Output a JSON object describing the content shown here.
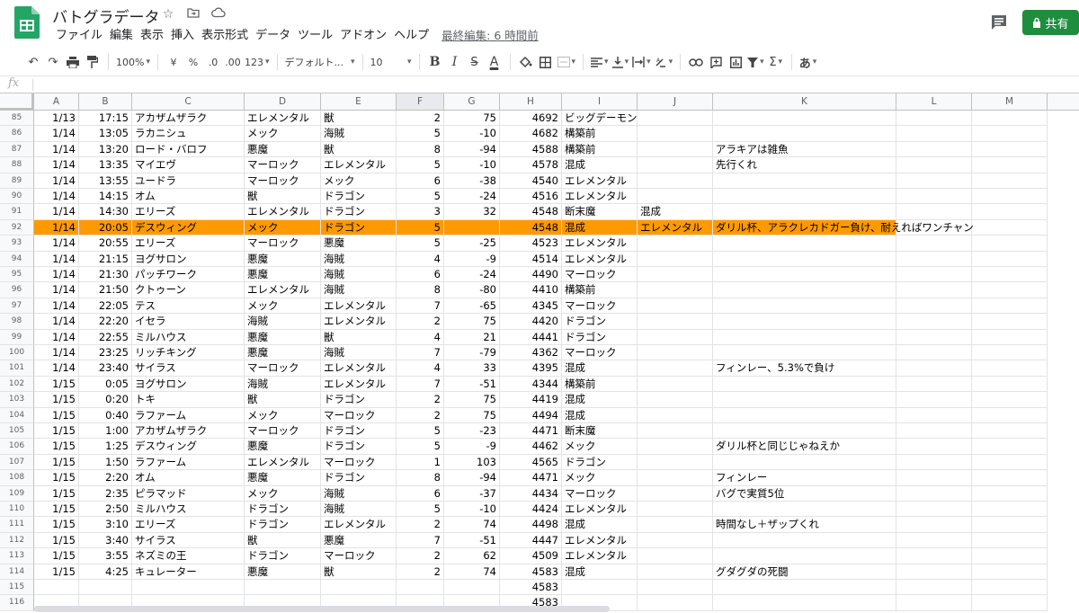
{
  "app": {
    "title": "バトグラデータ",
    "last_edit": "最終編集: 6 時間前",
    "share_label": "共有",
    "menu": [
      "ファイル",
      "編集",
      "表示",
      "挿入",
      "表示形式",
      "データ",
      "ツール",
      "アドオン",
      "ヘルプ"
    ],
    "accent_color": "#1e8e3e",
    "highlight_color": "#ff9900"
  },
  "toolbar": {
    "zoom": "100%",
    "currency": "¥",
    "percent": "%",
    "dec_less": ".0",
    "dec_more": ".00",
    "format_more": "123",
    "font": "デフォルト...",
    "font_size": "10",
    "bold": "B",
    "italic": "I",
    "strike": "S",
    "text_color": "A",
    "ime": "あ"
  },
  "formula_bar": {
    "fx": "fx",
    "value": ""
  },
  "columns": [
    "A",
    "B",
    "C",
    "D",
    "E",
    "F",
    "G",
    "H",
    "I",
    "J",
    "K",
    "L",
    "M"
  ],
  "highlighted_row": 92,
  "rows": [
    {
      "n": "85",
      "a": "1/13",
      "b": "17:15",
      "c": "アカザムザラク",
      "d": "エレメンタル",
      "e": "獣",
      "f": "2",
      "g": "75",
      "h": "4692",
      "i": "ビッグデーモン",
      "j": "",
      "k": ""
    },
    {
      "n": "86",
      "a": "1/14",
      "b": "13:05",
      "c": "ラカニシュ",
      "d": "メック",
      "e": "海賊",
      "f": "5",
      "g": "-10",
      "h": "4682",
      "i": "構築前",
      "j": "",
      "k": ""
    },
    {
      "n": "87",
      "a": "1/14",
      "b": "13:20",
      "c": "ロード・バロフ",
      "d": "悪魔",
      "e": "獣",
      "f": "8",
      "g": "-94",
      "h": "4588",
      "i": "構築前",
      "j": "",
      "k": "アラキアは雑魚"
    },
    {
      "n": "88",
      "a": "1/14",
      "b": "13:35",
      "c": "マイエヴ",
      "d": "マーロック",
      "e": "エレメンタル",
      "f": "5",
      "g": "-10",
      "h": "4578",
      "i": "混成",
      "j": "",
      "k": "先行くれ"
    },
    {
      "n": "89",
      "a": "1/14",
      "b": "13:55",
      "c": "ユードラ",
      "d": "マーロック",
      "e": "メック",
      "f": "6",
      "g": "-38",
      "h": "4540",
      "i": "エレメンタル",
      "j": "",
      "k": ""
    },
    {
      "n": "90",
      "a": "1/14",
      "b": "14:15",
      "c": "オム",
      "d": "獣",
      "e": "ドラゴン",
      "f": "5",
      "g": "-24",
      "h": "4516",
      "i": "エレメンタル",
      "j": "",
      "k": ""
    },
    {
      "n": "91",
      "a": "1/14",
      "b": "14:30",
      "c": "エリーズ",
      "d": "エレメンタル",
      "e": "ドラゴン",
      "f": "3",
      "g": "32",
      "h": "4548",
      "i": "断末魔",
      "j": "混成",
      "k": ""
    },
    {
      "n": "92",
      "a": "1/14",
      "b": "20:05",
      "c": "デスウィング",
      "d": "メック",
      "e": "ドラゴン",
      "f": "5",
      "g": "",
      "h": "4548",
      "i": "混成",
      "j": "エレメンタル",
      "k": "ダリル杯、アラクレカドガー負け、耐えればワンチャン"
    },
    {
      "n": "93",
      "a": "1/14",
      "b": "20:55",
      "c": "エリーズ",
      "d": "マーロック",
      "e": "悪魔",
      "f": "5",
      "g": "-25",
      "h": "4523",
      "i": "エレメンタル",
      "j": "",
      "k": ""
    },
    {
      "n": "94",
      "a": "1/14",
      "b": "21:15",
      "c": "ヨグサロン",
      "d": "悪魔",
      "e": "海賊",
      "f": "4",
      "g": "-9",
      "h": "4514",
      "i": "エレメンタル",
      "j": "",
      "k": ""
    },
    {
      "n": "95",
      "a": "1/14",
      "b": "21:30",
      "c": "パッチワーク",
      "d": "悪魔",
      "e": "海賊",
      "f": "6",
      "g": "-24",
      "h": "4490",
      "i": "マーロック",
      "j": "",
      "k": ""
    },
    {
      "n": "96",
      "a": "1/14",
      "b": "21:50",
      "c": "クトゥーン",
      "d": "エレメンタル",
      "e": "海賊",
      "f": "8",
      "g": "-80",
      "h": "4410",
      "i": "構築前",
      "j": "",
      "k": ""
    },
    {
      "n": "97",
      "a": "1/14",
      "b": "22:05",
      "c": "テス",
      "d": "メック",
      "e": "エレメンタル",
      "f": "7",
      "g": "-65",
      "h": "4345",
      "i": "マーロック",
      "j": "",
      "k": ""
    },
    {
      "n": "98",
      "a": "1/14",
      "b": "22:20",
      "c": "イセラ",
      "d": "海賊",
      "e": "エレメンタル",
      "f": "2",
      "g": "75",
      "h": "4420",
      "i": "ドラゴン",
      "j": "",
      "k": ""
    },
    {
      "n": "99",
      "a": "1/14",
      "b": "22:55",
      "c": "ミルハウス",
      "d": "悪魔",
      "e": "獣",
      "f": "4",
      "g": "21",
      "h": "4441",
      "i": "ドラゴン",
      "j": "",
      "k": ""
    },
    {
      "n": "100",
      "a": "1/14",
      "b": "23:25",
      "c": "リッチキング",
      "d": "悪魔",
      "e": "海賊",
      "f": "7",
      "g": "-79",
      "h": "4362",
      "i": "マーロック",
      "j": "",
      "k": ""
    },
    {
      "n": "101",
      "a": "1/14",
      "b": "23:40",
      "c": "サイラス",
      "d": "マーロック",
      "e": "エレメンタル",
      "f": "4",
      "g": "33",
      "h": "4395",
      "i": "混成",
      "j": "",
      "k": "フィンレー、5.3%で負け"
    },
    {
      "n": "102",
      "a": "1/15",
      "b": "0:05",
      "c": "ヨグサロン",
      "d": "海賊",
      "e": "エレメンタル",
      "f": "7",
      "g": "-51",
      "h": "4344",
      "i": "構築前",
      "j": "",
      "k": ""
    },
    {
      "n": "103",
      "a": "1/15",
      "b": "0:20",
      "c": "トキ",
      "d": "獣",
      "e": "ドラゴン",
      "f": "2",
      "g": "75",
      "h": "4419",
      "i": "混成",
      "j": "",
      "k": ""
    },
    {
      "n": "104",
      "a": "1/15",
      "b": "0:40",
      "c": "ラファーム",
      "d": "メック",
      "e": "マーロック",
      "f": "2",
      "g": "75",
      "h": "4494",
      "i": "混成",
      "j": "",
      "k": ""
    },
    {
      "n": "105",
      "a": "1/15",
      "b": "1:00",
      "c": "アカザムザラク",
      "d": "マーロック",
      "e": "ドラゴン",
      "f": "5",
      "g": "-23",
      "h": "4471",
      "i": "断末魔",
      "j": "",
      "k": ""
    },
    {
      "n": "106",
      "a": "1/15",
      "b": "1:25",
      "c": "デスウィング",
      "d": "悪魔",
      "e": "ドラゴン",
      "f": "5",
      "g": "-9",
      "h": "4462",
      "i": "メック",
      "j": "",
      "k": "ダリル杯と同じじゃねえか"
    },
    {
      "n": "107",
      "a": "1/15",
      "b": "1:50",
      "c": "ラファーム",
      "d": "エレメンタル",
      "e": "マーロック",
      "f": "1",
      "g": "103",
      "h": "4565",
      "i": "ドラゴン",
      "j": "",
      "k": ""
    },
    {
      "n": "108",
      "a": "1/15",
      "b": "2:20",
      "c": "オム",
      "d": "悪魔",
      "e": "ドラゴン",
      "f": "8",
      "g": "-94",
      "h": "4471",
      "i": "メック",
      "j": "",
      "k": "フィンレー"
    },
    {
      "n": "109",
      "a": "1/15",
      "b": "2:35",
      "c": "ピラマッド",
      "d": "メック",
      "e": "海賊",
      "f": "6",
      "g": "-37",
      "h": "4434",
      "i": "マーロック",
      "j": "",
      "k": "バグで実質5位"
    },
    {
      "n": "110",
      "a": "1/15",
      "b": "2:50",
      "c": "ミルハウス",
      "d": "ドラゴン",
      "e": "海賊",
      "f": "5",
      "g": "-10",
      "h": "4424",
      "i": "エレメンタル",
      "j": "",
      "k": ""
    },
    {
      "n": "111",
      "a": "1/15",
      "b": "3:10",
      "c": "エリーズ",
      "d": "ドラゴン",
      "e": "エレメンタル",
      "f": "2",
      "g": "74",
      "h": "4498",
      "i": "混成",
      "j": "",
      "k": "時間なし＋ザップくれ"
    },
    {
      "n": "112",
      "a": "1/15",
      "b": "3:40",
      "c": "サイラス",
      "d": "獣",
      "e": "悪魔",
      "f": "7",
      "g": "-51",
      "h": "4447",
      "i": "エレメンタル",
      "j": "",
      "k": ""
    },
    {
      "n": "113",
      "a": "1/15",
      "b": "3:55",
      "c": "ネズミの王",
      "d": "ドラゴン",
      "e": "マーロック",
      "f": "2",
      "g": "62",
      "h": "4509",
      "i": "エレメンタル",
      "j": "",
      "k": ""
    },
    {
      "n": "114",
      "a": "1/15",
      "b": "4:25",
      "c": "キュレーター",
      "d": "悪魔",
      "e": "獣",
      "f": "2",
      "g": "74",
      "h": "4583",
      "i": "混成",
      "j": "",
      "k": "グダグダの死闘"
    },
    {
      "n": "115",
      "a": "",
      "b": "",
      "c": "",
      "d": "",
      "e": "",
      "f": "",
      "g": "",
      "h": "4583",
      "i": "",
      "j": "",
      "k": ""
    },
    {
      "n": "116",
      "a": "",
      "b": "",
      "c": "",
      "d": "",
      "e": "",
      "f": "",
      "g": "",
      "h": "4583",
      "i": "",
      "j": "",
      "k": ""
    }
  ]
}
